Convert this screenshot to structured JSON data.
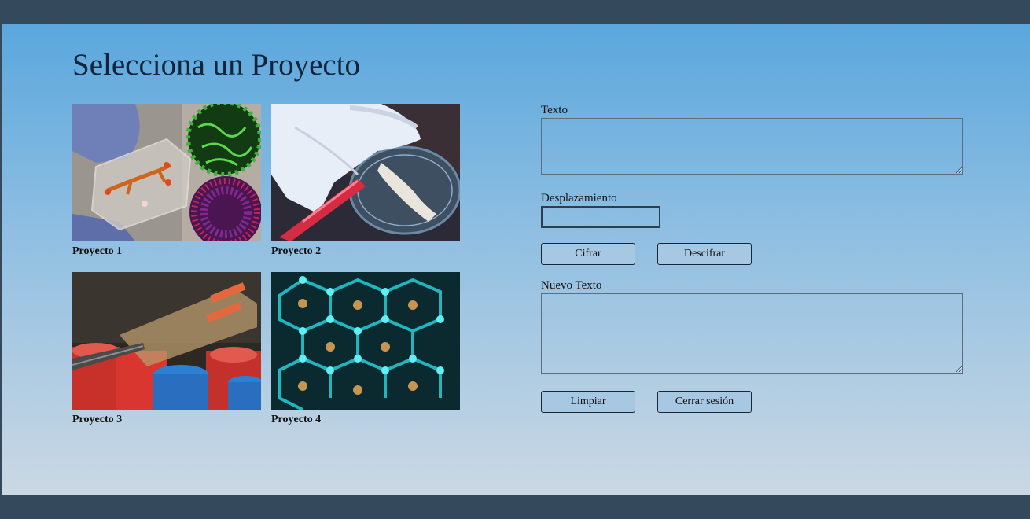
{
  "page": {
    "title": "Selecciona un Proyecto"
  },
  "projects": [
    {
      "label": "Proyecto 1",
      "image": "microfluidic-chip-photo"
    },
    {
      "label": "Proyecto 2",
      "image": "petri-dish-glove-photo"
    },
    {
      "label": "Proyecto 3",
      "image": "lab-chip-tubes-photo"
    },
    {
      "label": "Proyecto 4",
      "image": "molecular-lattice-photo"
    }
  ],
  "form": {
    "text_label": "Texto",
    "text_value": "",
    "shift_label": "Desplazamiento",
    "shift_value": "",
    "encrypt_button": "Cifrar",
    "decrypt_button": "Descifrar",
    "new_text_label": "Nuevo Texto",
    "new_text_value": "",
    "clear_button": "Limpiar",
    "logout_button": "Cerrar sesión"
  },
  "colors": {
    "bar": "#34495b",
    "gradient_top": "#5aa7dd",
    "gradient_bottom": "#cbd8e3",
    "button": "#a7c8e2"
  }
}
